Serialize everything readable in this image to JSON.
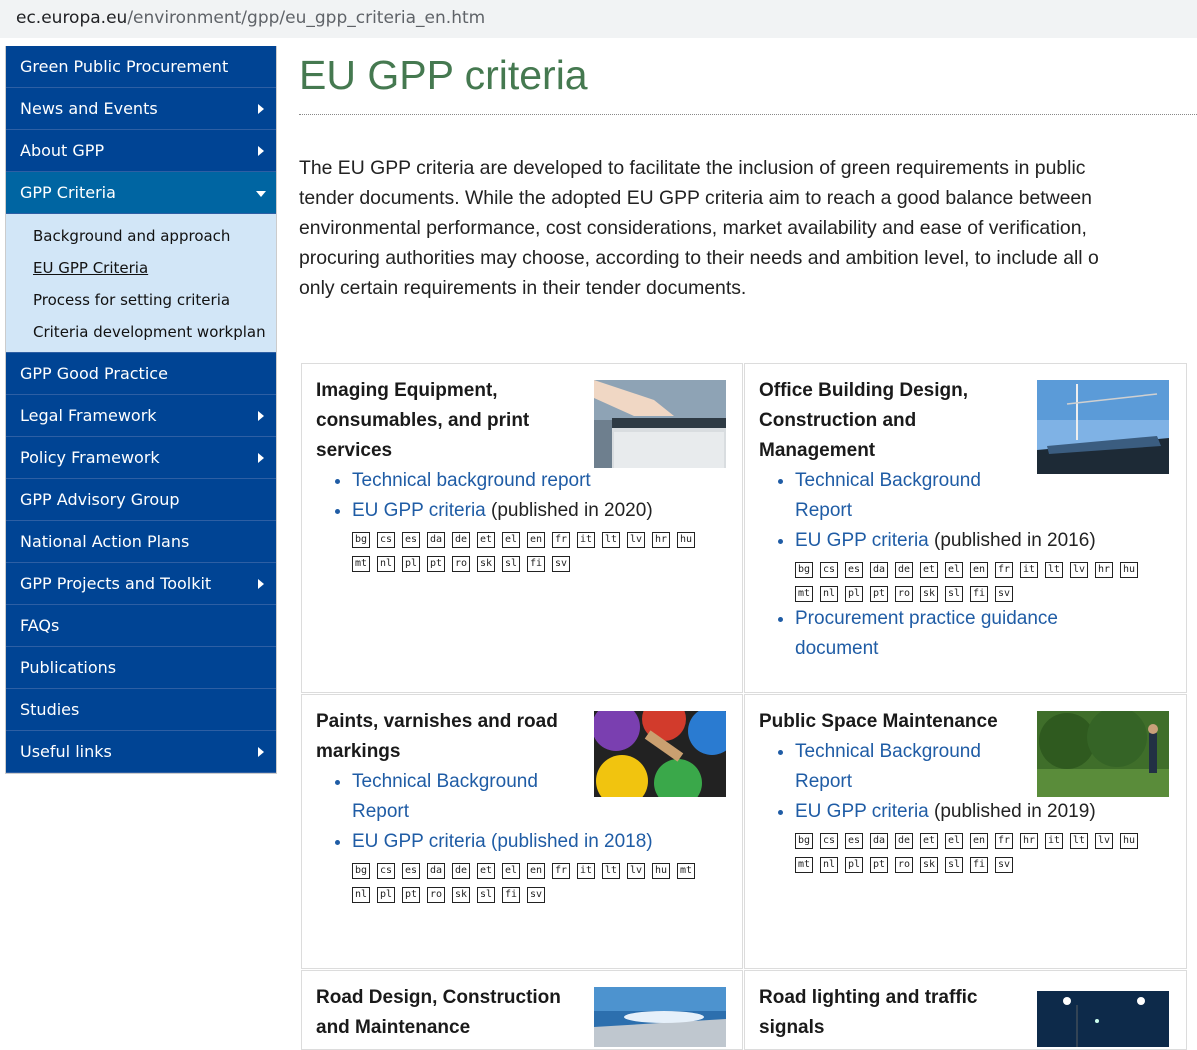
{
  "url": {
    "host": "ec.europa.eu",
    "path": "/environment/gpp/eu_gpp_criteria_en.htm"
  },
  "sidebar": {
    "items": [
      {
        "label": "Green Public Procurement",
        "arrow": false
      },
      {
        "label": "News and Events",
        "arrow": true
      },
      {
        "label": "About GPP",
        "arrow": true
      },
      {
        "label": "GPP Criteria",
        "arrow": "down"
      },
      {
        "label": "GPP Good Practice",
        "arrow": false
      },
      {
        "label": "Legal Framework",
        "arrow": true
      },
      {
        "label": "Policy Framework",
        "arrow": true
      },
      {
        "label": "GPP Advisory Group",
        "arrow": false
      },
      {
        "label": "National Action Plans",
        "arrow": false
      },
      {
        "label": "GPP Projects and Toolkit",
        "arrow": true
      },
      {
        "label": "FAQs",
        "arrow": false
      },
      {
        "label": "Publications",
        "arrow": false
      },
      {
        "label": "Studies",
        "arrow": false
      },
      {
        "label": "Useful links",
        "arrow": true
      }
    ],
    "subitems": [
      "Background and approach",
      "EU GPP Criteria",
      "Process for setting criteria",
      "Criteria development workplan"
    ]
  },
  "page": {
    "title": "EU GPP criteria",
    "intro": [
      "The EU GPP criteria are developed to facilitate the inclusion of green requirements in public",
      "tender documents. While the adopted EU GPP criteria aim to reach a good balance between",
      "environmental performance, cost considerations, market availability and ease of verification,",
      "procuring authorities may choose, according to their needs and ambition level, to include all o",
      "only certain requirements in their tender documents."
    ]
  },
  "cards": {
    "imaging": {
      "title": [
        "Imaging Equipment,",
        "consumables, and print",
        "services"
      ],
      "link1": "Technical background report",
      "link2": "EU GPP criteria",
      "link2_suffix": " (published in 2020)",
      "langs": [
        "bg",
        "cs",
        "es",
        "da",
        "de",
        "et",
        "el",
        "en",
        "fr",
        "it",
        "lt",
        "lv",
        "hr",
        "hu",
        "mt",
        "nl",
        "pl",
        "pt",
        "ro",
        "sk",
        "sl",
        "fi",
        "sv"
      ]
    },
    "office": {
      "title": [
        "Office Building Design,",
        "Construction and",
        "Management"
      ],
      "link1": [
        "Technical Background",
        "Report"
      ],
      "link2": "EU GPP criteria",
      "link2_suffix": " (published in 2016)",
      "langs": [
        "bg",
        "cs",
        "es",
        "da",
        "de",
        "et",
        "el",
        "en",
        "fr",
        "it",
        "lt",
        "lv",
        "hr",
        "hu",
        "mt",
        "nl",
        "pl",
        "pt",
        "ro",
        "sk",
        "sl",
        "fi",
        "sv"
      ],
      "link3": [
        "Procurement practice guidance",
        "document"
      ]
    },
    "paints": {
      "title": [
        "Paints, varnishes and road",
        "markings"
      ],
      "link1": [
        "Technical Background",
        "Report"
      ],
      "link2": "EU GPP criteria (published in 2018)",
      "langs": [
        "bg",
        "cs",
        "es",
        "da",
        "de",
        "et",
        "el",
        "en",
        "fr",
        "it",
        "lt",
        "lv",
        "hu",
        "mt",
        "nl",
        "pl",
        "pt",
        "ro",
        "sk",
        "sl",
        "fi",
        "sv"
      ]
    },
    "publicspace": {
      "title": [
        "Public Space Maintenance"
      ],
      "link1": [
        "Technical Background",
        "Report"
      ],
      "link2": "EU GPP criteria",
      "link2_suffix": " (published in 2019)",
      "langs": [
        "bg",
        "cs",
        "es",
        "da",
        "de",
        "et",
        "el",
        "en",
        "fr",
        "hr",
        "it",
        "lt",
        "lv",
        "hu",
        "mt",
        "nl",
        "pl",
        "pt",
        "ro",
        "sk",
        "sl",
        "fi",
        "sv"
      ]
    },
    "road": {
      "title": [
        "Road Design, Construction",
        "and Maintenance"
      ]
    },
    "lighting": {
      "title": [
        "Road lighting and traffic",
        "signals"
      ]
    }
  }
}
